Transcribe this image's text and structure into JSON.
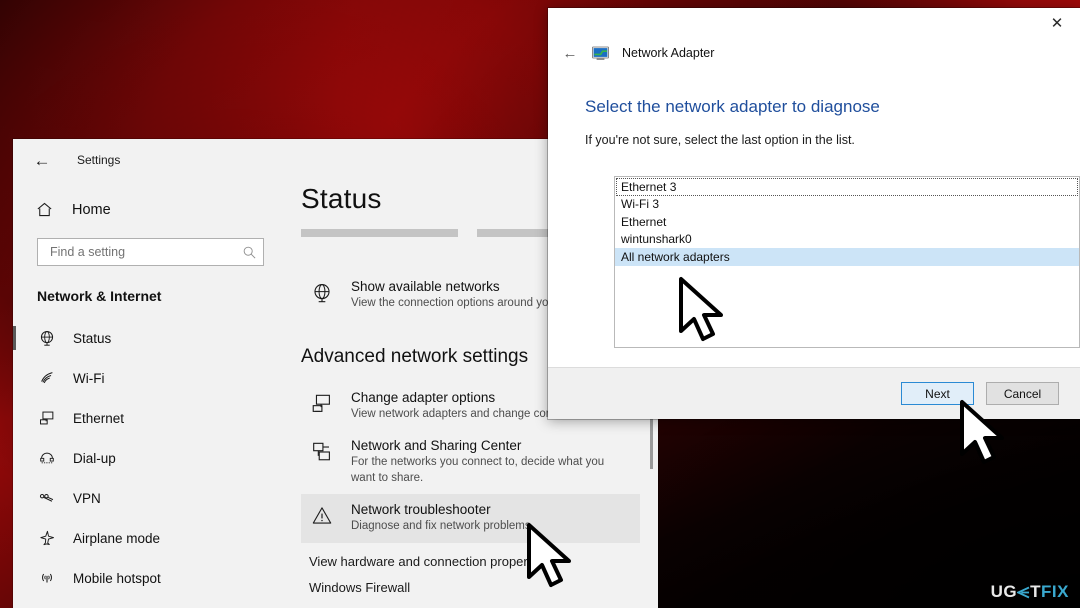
{
  "desktop": {
    "wallpaper_description": "dark red grunge gradient"
  },
  "watermark": {
    "part1": "UG",
    "e_glyph": "stylized-e-icon",
    "part2": "T",
    "part3": "FIX"
  },
  "settings": {
    "titlebar": {
      "back_label": "←",
      "title": "Settings"
    },
    "home": {
      "label": "Home",
      "icon": "home-icon"
    },
    "search": {
      "placeholder": "Find a setting",
      "value": "",
      "icon": "search-icon"
    },
    "section_label": "Network & Internet",
    "nav_items": [
      {
        "label": "Status",
        "icon": "globe-icon",
        "selected": true
      },
      {
        "label": "Wi-Fi",
        "icon": "wifi-icon",
        "selected": false
      },
      {
        "label": "Ethernet",
        "icon": "ethernet-icon",
        "selected": false
      },
      {
        "label": "Dial-up",
        "icon": "dialup-phone-icon",
        "selected": false
      },
      {
        "label": "VPN",
        "icon": "vpn-icon",
        "selected": false
      },
      {
        "label": "Airplane mode",
        "icon": "airplane-icon",
        "selected": false
      },
      {
        "label": "Mobile hotspot",
        "icon": "hotspot-icon",
        "selected": false
      }
    ],
    "main": {
      "page_title": "Status",
      "redacted_bars": 2,
      "options": [
        {
          "title": "Show available networks",
          "subtitle": "View the connection options around you.",
          "icon": "globe-icon",
          "highlight": false
        }
      ],
      "advanced_title": "Advanced network settings",
      "advanced_options": [
        {
          "title": "Change adapter options",
          "subtitle": "View network adapters and change connecti",
          "icon": "monitor-network-icon",
          "highlight": false
        },
        {
          "title": "Network and Sharing Center",
          "subtitle": "For the networks you connect to, decide what you want to share.",
          "icon": "sharing-center-icon",
          "highlight": false
        },
        {
          "title": "Network troubleshooter",
          "subtitle": "Diagnose and fix network problems.",
          "icon": "warning-triangle-icon",
          "highlight": true
        }
      ],
      "links": [
        "View hardware and connection properties",
        "Windows Firewall"
      ]
    }
  },
  "dialog": {
    "close_label": "✕",
    "back_label": "←",
    "header_icon": "network-adapter-icon",
    "header_title": "Network Adapter",
    "heading": "Select the network adapter to diagnose",
    "subheading": "If you're not sure, select the last option in the list.",
    "list_items": [
      {
        "label": "Ethernet 3",
        "focused": true,
        "selected": false
      },
      {
        "label": "Wi-Fi 3",
        "focused": false,
        "selected": false
      },
      {
        "label": "Ethernet",
        "focused": false,
        "selected": false
      },
      {
        "label": "wintunshark0",
        "focused": false,
        "selected": false
      },
      {
        "label": "All network adapters",
        "focused": false,
        "selected": true
      }
    ],
    "buttons": {
      "next": "Next",
      "cancel": "Cancel"
    }
  },
  "cursors": [
    {
      "name": "cursor-over-list-selection"
    },
    {
      "name": "cursor-over-next-button"
    },
    {
      "name": "cursor-over-network-troubleshooter"
    }
  ],
  "colors": {
    "accent_blue": "#1f4e9c",
    "selection_blue": "#cce4f7",
    "primary_button_border": "#2a8ad4",
    "wallpaper_red": "#b40b0b",
    "watermark_teal": "#3aa9cf"
  }
}
